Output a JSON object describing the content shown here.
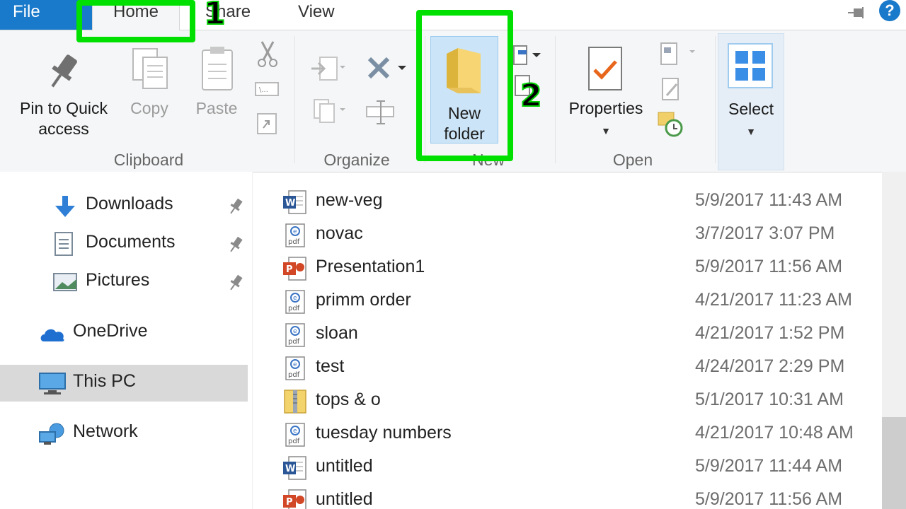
{
  "menu": {
    "file": "File",
    "home": "Home",
    "share": "Share",
    "view": "View",
    "help": "?"
  },
  "ribbon": {
    "pin_label_1": "Pin to Quick",
    "pin_label_2": "access",
    "copy": "Copy",
    "paste": "Paste",
    "new_folder_1": "New",
    "new_folder_2": "folder",
    "properties": "Properties",
    "select": "Select",
    "groups": {
      "clipboard": "Clipboard",
      "organize": "Organize",
      "new": "New",
      "open": "Open"
    }
  },
  "callouts": {
    "step1": "1",
    "step2": "2"
  },
  "nav": {
    "downloads": "Downloads",
    "documents": "Documents",
    "pictures": "Pictures",
    "onedrive": "OneDrive",
    "thispc": "This PC",
    "network": "Network"
  },
  "files": [
    {
      "icon": "word-icon",
      "name": "new-veg",
      "date": "5/9/2017 11:43 AM"
    },
    {
      "icon": "pdf-icon",
      "name": "novac",
      "date": "3/7/2017 3:07 PM"
    },
    {
      "icon": "powerpoint-icon",
      "name": "Presentation1",
      "date": "5/9/2017 11:56 AM"
    },
    {
      "icon": "pdf-icon",
      "name": "primm order",
      "date": "4/21/2017 11:23 AM"
    },
    {
      "icon": "pdf-icon",
      "name": "sloan",
      "date": "4/21/2017 1:52 PM"
    },
    {
      "icon": "pdf-icon",
      "name": "test",
      "date": "4/24/2017 2:29 PM"
    },
    {
      "icon": "zip-icon",
      "name": "tops & o",
      "date": "5/1/2017 10:31 AM"
    },
    {
      "icon": "pdf-icon",
      "name": "tuesday numbers",
      "date": "4/21/2017 10:48 AM"
    },
    {
      "icon": "word-icon",
      "name": "untitled",
      "date": "5/9/2017 11:44 AM"
    },
    {
      "icon": "powerpoint-icon",
      "name": "untitled",
      "date": "5/9/2017 11:56 AM"
    }
  ],
  "colors": {
    "accent": "#1979ca",
    "highlight": "#00e000",
    "selected_bg": "#d9d9d9"
  }
}
